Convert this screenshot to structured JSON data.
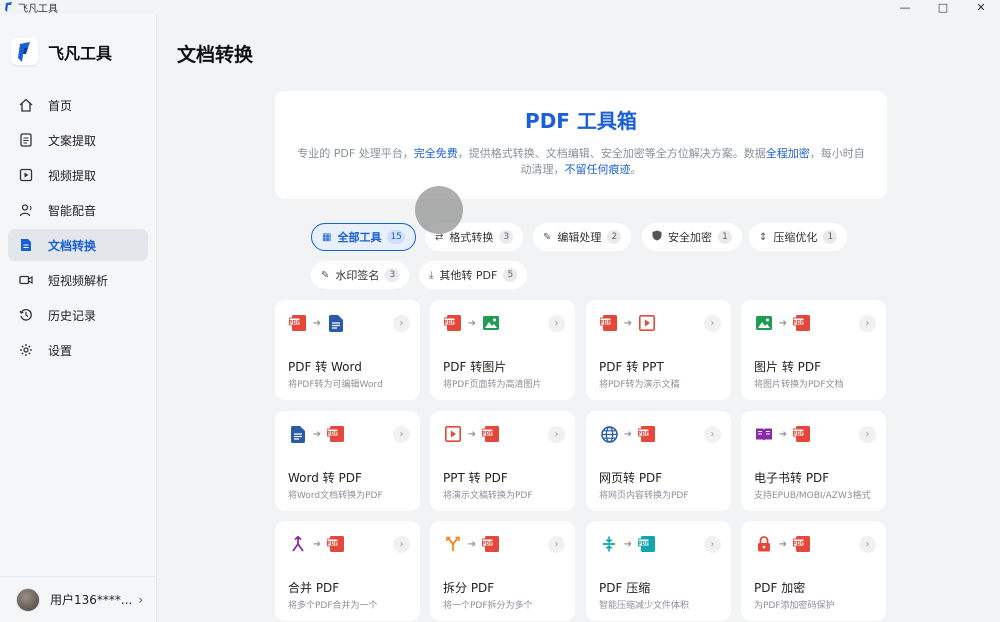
{
  "window": {
    "title": "飞凡工具",
    "controls": [
      "minimize",
      "maximize",
      "close"
    ]
  },
  "sidebar": {
    "brand": "飞凡工具",
    "items": [
      {
        "label": "首页",
        "icon": "home-icon",
        "active": false
      },
      {
        "label": "文案提取",
        "icon": "document-text-icon",
        "active": false
      },
      {
        "label": "视频提取",
        "icon": "video-extract-icon",
        "active": false
      },
      {
        "label": "智能配音",
        "icon": "voice-icon",
        "active": false
      },
      {
        "label": "文档转换",
        "icon": "file-convert-icon",
        "active": true
      },
      {
        "label": "短视频解析",
        "icon": "video-camera-icon",
        "active": false
      },
      {
        "label": "历史记录",
        "icon": "history-icon",
        "active": false
      },
      {
        "label": "设置",
        "icon": "gear-icon",
        "active": false
      }
    ],
    "user": {
      "name": "用户136****..."
    }
  },
  "main": {
    "page_title": "文档转换",
    "hero": {
      "title": "PDF 工具箱",
      "desc_1": "专业的 PDF 处理平台，",
      "hl_1": "完全免费",
      "desc_2": "，提供格式转换、文档编辑、安全加密等全方位解决方案。数据",
      "hl_2": "全程加密",
      "desc_3": "，每小时自动清理，",
      "hl_3": "不留任何痕迹",
      "desc_4": "。"
    },
    "filters": [
      {
        "label": "全部工具",
        "count": "15",
        "icon": "grid-icon",
        "active": true
      },
      {
        "label": "格式转换",
        "count": "3",
        "icon": "swap-icon",
        "active": false
      },
      {
        "label": "编辑处理",
        "count": "2",
        "icon": "edit-icon",
        "active": false
      },
      {
        "label": "安全加密",
        "count": "1",
        "icon": "shield-icon",
        "active": false
      },
      {
        "label": "压缩优化",
        "count": "1",
        "icon": "compress-icon",
        "active": false
      },
      {
        "label": "水印签名",
        "count": "3",
        "icon": "stamp-icon",
        "active": false
      },
      {
        "label": "其他转 PDF",
        "count": "5",
        "icon": "download-icon",
        "active": false
      }
    ],
    "tools": [
      {
        "title": "PDF 转 Word",
        "desc": "将PDF转为可编辑Word",
        "from": "pdf-icon",
        "to": "word-icon"
      },
      {
        "title": "PDF 转图片",
        "desc": "将PDF页面转为高清图片",
        "from": "pdf-icon",
        "to": "image-icon"
      },
      {
        "title": "PDF 转 PPT",
        "desc": "将PDF转为演示文稿",
        "from": "pdf-icon",
        "to": "ppt-icon"
      },
      {
        "title": "图片 转 PDF",
        "desc": "将图片转换为PDF文档",
        "from": "image-icon",
        "to": "pdf-icon"
      },
      {
        "title": "Word 转 PDF",
        "desc": "将Word文档转换为PDF",
        "from": "word-icon",
        "to": "pdf-icon"
      },
      {
        "title": "PPT 转 PDF",
        "desc": "将演示文稿转换为PDF",
        "from": "ppt-icon",
        "to": "pdf-icon"
      },
      {
        "title": "网页转 PDF",
        "desc": "将网页内容转换为PDF",
        "from": "globe-icon",
        "to": "pdf-icon"
      },
      {
        "title": "电子书转 PDF",
        "desc": "支持EPUB/MOBI/AZW3格式",
        "from": "ebook-icon",
        "to": "pdf-icon"
      },
      {
        "title": "合并 PDF",
        "desc": "将多个PDF合并为一个",
        "from": "merge-icon",
        "to": "pdf-icon"
      },
      {
        "title": "拆分 PDF",
        "desc": "将一个PDF拆分为多个",
        "from": "split-icon",
        "to": "pdf-icon"
      },
      {
        "title": "PDF 压缩",
        "desc": "智能压缩减少文件体积",
        "from": "compress-icon",
        "to": "pdf-icon"
      },
      {
        "title": "PDF 加密",
        "desc": "为PDF添加密码保护",
        "from": "lock-icon",
        "to": "pdf-icon"
      }
    ]
  },
  "colors": {
    "accent": "#1a5fd6",
    "pdf_red": "#e5483b",
    "word_blue": "#2b5aa8",
    "image_green": "#1f9d55",
    "ebook_purple": "#8a2aa8",
    "teal": "#12a5b0",
    "orange": "#f08a1c"
  }
}
